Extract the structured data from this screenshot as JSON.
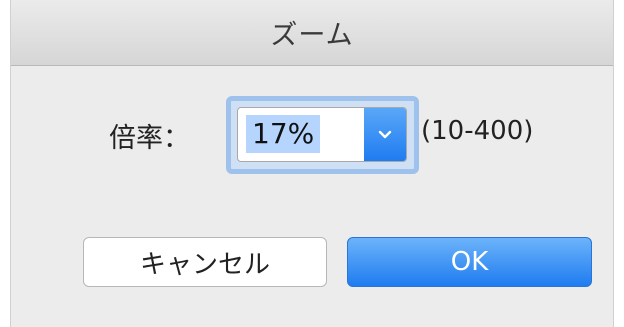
{
  "dialog": {
    "title": "ズーム"
  },
  "zoom": {
    "label": "倍率：",
    "value": "17%",
    "range": "(10-400)"
  },
  "buttons": {
    "cancel": "キャンセル",
    "ok": "OK"
  },
  "colors": {
    "accent": "#1f7cf0",
    "focus_ring": "#9ec2ec",
    "selection": "#b5d5ff"
  },
  "icons": {
    "dropdown": "chevron-down-icon"
  }
}
